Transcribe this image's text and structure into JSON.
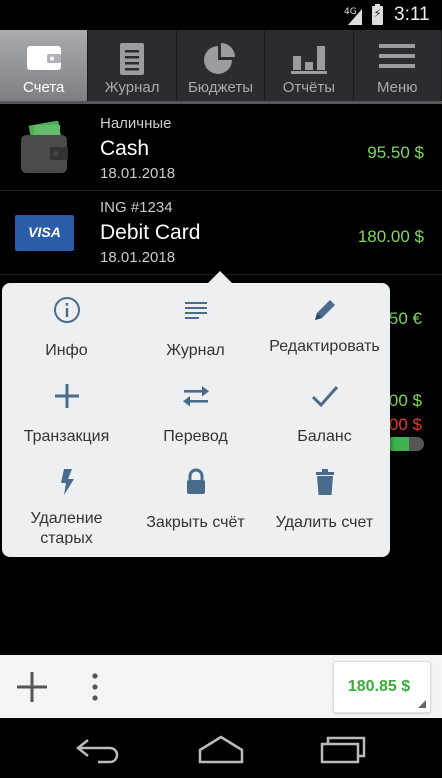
{
  "status_bar": {
    "network": "4G",
    "battery_symbol": "⚡",
    "time": "3:11"
  },
  "tabs": [
    {
      "label": "Счета",
      "icon": "wallet-icon",
      "active": true
    },
    {
      "label": "Журнал",
      "icon": "document-icon",
      "active": false
    },
    {
      "label": "Бюджеты",
      "icon": "pie-chart-icon",
      "active": false
    },
    {
      "label": "Отчёты",
      "icon": "bar-chart-icon",
      "active": false
    },
    {
      "label": "Меню",
      "icon": "hamburger-icon",
      "active": false
    }
  ],
  "accounts": [
    {
      "bank": "Наличные",
      "name": "Cash",
      "date": "18.01.2018",
      "balance": "95.50 $",
      "icon": "wallet-money-icon"
    },
    {
      "bank": "ING #1234",
      "name": "Debit Card",
      "date": "18.01.2018",
      "balance": "180.00 $",
      "icon": "visa-card-icon",
      "card_text": "VISA"
    }
  ],
  "hidden_rows": {
    "row3_balance": "50 €",
    "row4_balance_green": "00 $",
    "row4_balance_red": "00 $",
    "row4_progress": 0.6
  },
  "popup_menu": {
    "items": [
      {
        "label": "Инфо",
        "icon": "info-icon"
      },
      {
        "label": "Журнал",
        "icon": "list-icon"
      },
      {
        "label": "Редактировать",
        "icon": "pencil-icon"
      },
      {
        "label": "Транзакция",
        "icon": "plus-icon"
      },
      {
        "label": "Перевод",
        "icon": "transfer-arrows-icon"
      },
      {
        "label": "Баланс",
        "icon": "checkmark-icon"
      },
      {
        "label": "Удаление старых",
        "icon": "lightning-icon"
      },
      {
        "label": "Закрыть счёт",
        "icon": "lock-icon"
      },
      {
        "label": "Удалить счет",
        "icon": "trash-icon"
      }
    ]
  },
  "bottom_bar": {
    "total": "180.85 $"
  },
  "colors": {
    "positive": "#7ed957",
    "negative": "#e53935",
    "popup_icon": "#4a6c8c",
    "total": "#3cab3c"
  }
}
